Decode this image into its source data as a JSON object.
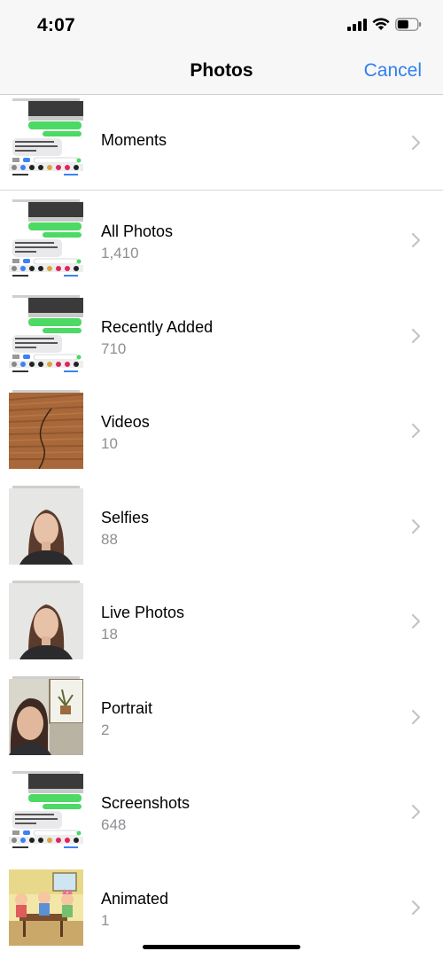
{
  "status_bar": {
    "time": "4:07",
    "icons": [
      "cellular-signal-icon",
      "wifi-icon",
      "battery-icon"
    ]
  },
  "nav": {
    "title": "Photos",
    "cancel_label": "Cancel"
  },
  "albums": [
    {
      "name": "Moments",
      "count": "",
      "thumbnail": "messages-screenshot-thumbnail"
    },
    {
      "name": "All Photos",
      "count": "1,410",
      "thumbnail": "messages-screenshot-thumbnail"
    },
    {
      "name": "Recently Added",
      "count": "710",
      "thumbnail": "messages-screenshot-thumbnail"
    },
    {
      "name": "Videos",
      "count": "10",
      "thumbnail": "wood-floor-thumbnail"
    },
    {
      "name": "Selfies",
      "count": "88",
      "thumbnail": "selfie-thumbnail"
    },
    {
      "name": "Live Photos",
      "count": "18",
      "thumbnail": "selfie-thumbnail"
    },
    {
      "name": "Portrait",
      "count": "2",
      "thumbnail": "portrait-thumbnail"
    },
    {
      "name": "Screenshots",
      "count": "648",
      "thumbnail": "messages-screenshot-thumbnail"
    },
    {
      "name": "Animated",
      "count": "1",
      "thumbnail": "cartoon-thumbnail"
    }
  ],
  "colors": {
    "accent": "#2f80ed",
    "secondary_text": "#8e8e93",
    "bar_background": "#f7f7f7",
    "message_bubble_green": "#4cd964"
  }
}
